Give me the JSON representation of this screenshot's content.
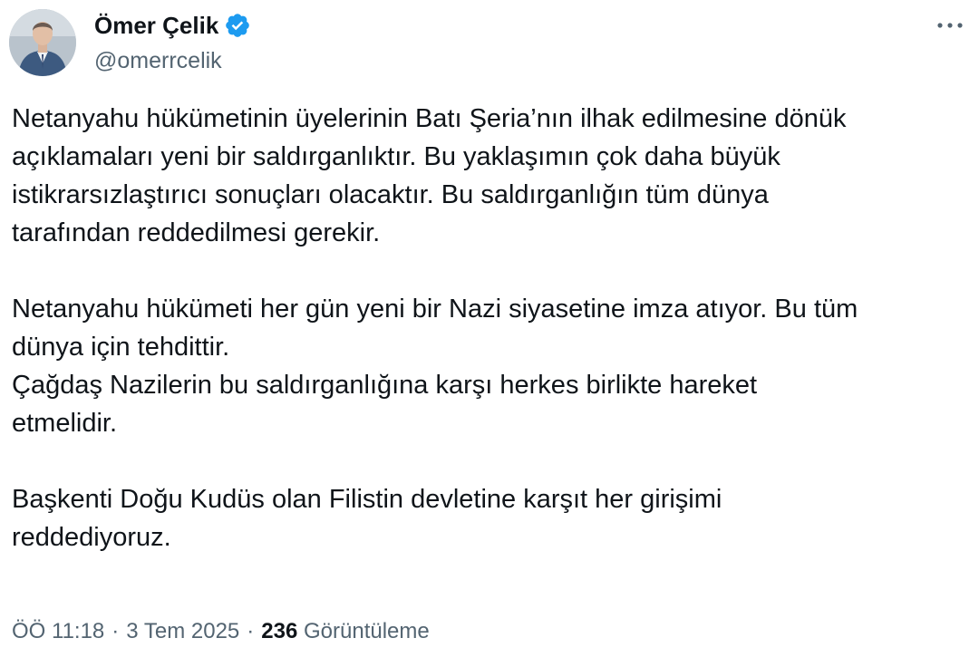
{
  "author": {
    "display_name": "Ömer Çelik",
    "handle": "@omerrcelik",
    "verified_icon": "verified-badge-icon",
    "avatar_icon": "profile-photo"
  },
  "menu": {
    "more_icon": "more-horizontal-icon"
  },
  "tweet": {
    "paragraphs": [
      [
        "Netanyahu hükümetinin üyelerinin Batı Şeria’nın ilhak edilmesine dönük",
        "açıklamaları yeni bir saldırganlıktır. Bu yaklaşımın çok daha büyük",
        "istikrarsızlaştırıcı sonuçları olacaktır. Bu saldırganlığın tüm dünya",
        "tarafından reddedilmesi gerekir."
      ],
      [
        "Netanyahu hükümeti her gün yeni bir Nazi siyasetine imza atıyor. Bu tüm",
        "dünya için tehdittir.",
        "Çağdaş Nazilerin bu saldırganlığına karşı herkes birlikte hareket",
        "etmelidir."
      ],
      [
        "Başkenti Doğu Kudüs olan Filistin devletine karşıt her girişimi",
        "reddediyoruz."
      ]
    ]
  },
  "meta": {
    "time": "ÖÖ 11:18",
    "separator": "·",
    "date": "3 Tem 2025",
    "views_count": "236",
    "views_label": "Görüntüleme"
  },
  "colors": {
    "text_primary": "#0f1419",
    "text_secondary": "#536471",
    "verified_blue": "#1d9bf0"
  }
}
